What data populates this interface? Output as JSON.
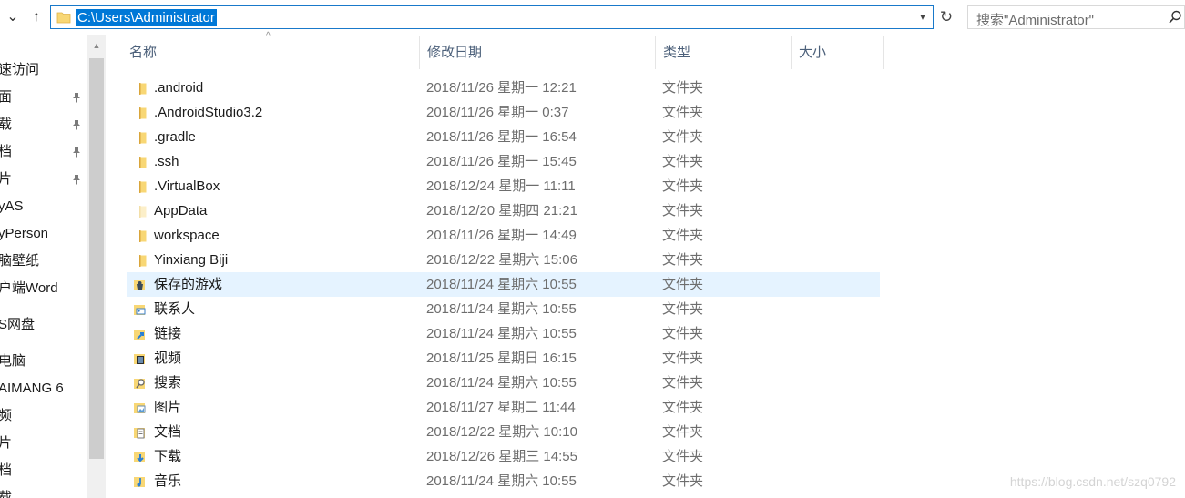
{
  "address_bar": {
    "path": "C:\\Users\\Administrator"
  },
  "search": {
    "placeholder": "搜索\"Administrator\""
  },
  "nav_pane": {
    "items": [
      {
        "label": "速访问",
        "pinned": false
      },
      {
        "label": "面",
        "pinned": true
      },
      {
        "label": "载",
        "pinned": true
      },
      {
        "label": "档",
        "pinned": true
      },
      {
        "label": "片",
        "pinned": true
      },
      {
        "label": "yAS",
        "pinned": false
      },
      {
        "label": "yPerson",
        "pinned": false
      },
      {
        "label": "脑壁纸",
        "pinned": false
      },
      {
        "label": "户端Word",
        "pinned": false
      },
      {
        "label": "S网盘",
        "pinned": false
      },
      {
        "label": "电脑",
        "pinned": false
      },
      {
        "label": "AIMANG 6",
        "pinned": false
      },
      {
        "label": "频",
        "pinned": false
      },
      {
        "label": "片",
        "pinned": false
      },
      {
        "label": "档",
        "pinned": false
      },
      {
        "label": "载",
        "pinned": false
      }
    ]
  },
  "columns": {
    "name": "名称",
    "date": "修改日期",
    "type": "类型",
    "size": "大小"
  },
  "files": [
    {
      "name": ".android",
      "date": "2018/11/26 星期一 12:21",
      "type": "文件夹",
      "icon": "folder-icon"
    },
    {
      "name": ".AndroidStudio3.2",
      "date": "2018/11/26 星期一 0:37",
      "type": "文件夹",
      "icon": "folder-icon"
    },
    {
      "name": ".gradle",
      "date": "2018/11/26 星期一 16:54",
      "type": "文件夹",
      "icon": "folder-icon"
    },
    {
      "name": ".ssh",
      "date": "2018/11/26 星期一 15:45",
      "type": "文件夹",
      "icon": "folder-icon"
    },
    {
      "name": ".VirtualBox",
      "date": "2018/12/24 星期一 11:11",
      "type": "文件夹",
      "icon": "folder-icon"
    },
    {
      "name": "AppData",
      "date": "2018/12/20 星期四 21:21",
      "type": "文件夹",
      "icon": "hidden-folder-icon"
    },
    {
      "name": "workspace",
      "date": "2018/11/26 星期一 14:49",
      "type": "文件夹",
      "icon": "folder-icon"
    },
    {
      "name": "Yinxiang Biji",
      "date": "2018/12/22 星期六 15:06",
      "type": "文件夹",
      "icon": "folder-icon"
    },
    {
      "name": "保存的游戏",
      "date": "2018/11/24 星期六 10:55",
      "type": "文件夹",
      "icon": "saved-games-icon",
      "selected": true
    },
    {
      "name": "联系人",
      "date": "2018/11/24 星期六 10:55",
      "type": "文件夹",
      "icon": "contacts-icon"
    },
    {
      "name": "链接",
      "date": "2018/11/24 星期六 10:55",
      "type": "文件夹",
      "icon": "links-icon"
    },
    {
      "name": "视频",
      "date": "2018/11/25 星期日 16:15",
      "type": "文件夹",
      "icon": "videos-icon"
    },
    {
      "name": "搜索",
      "date": "2018/11/24 星期六 10:55",
      "type": "文件夹",
      "icon": "searches-icon"
    },
    {
      "name": "图片",
      "date": "2018/11/27 星期二 11:44",
      "type": "文件夹",
      "icon": "pictures-icon"
    },
    {
      "name": "文档",
      "date": "2018/12/22 星期六 10:10",
      "type": "文件夹",
      "icon": "documents-icon"
    },
    {
      "name": "下载",
      "date": "2018/12/26 星期三 14:55",
      "type": "文件夹",
      "icon": "downloads-icon"
    },
    {
      "name": "音乐",
      "date": "2018/11/24 星期六 10:55",
      "type": "文件夹",
      "icon": "music-icon"
    }
  ],
  "watermark": "https://blog.csdn.net/szq0792",
  "colors": {
    "accent": "#0078d7",
    "selection": "#e5f3ff",
    "folder": "#f8d775"
  }
}
